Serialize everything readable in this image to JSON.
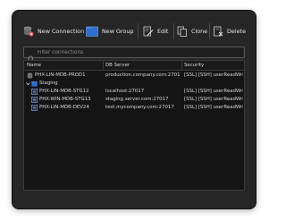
{
  "toolbar": {
    "new_connection_label": "New Connection",
    "new_group_label": "New Group",
    "edit_label": "Edit",
    "clone_label": "Clone",
    "delete_label": "Delete"
  },
  "filter": {
    "placeholder": "Filter connections"
  },
  "table": {
    "columns": [
      "Name",
      "DB Server",
      "Security"
    ],
    "rows": [
      {
        "name": "PHX-LIN-MDB-PROD1",
        "server": "production.company.com:27017",
        "security": "[SSL] [SSH] userReadWri..."
      },
      {
        "name": "Staging",
        "server": "",
        "security": ""
      },
      {
        "name": "PHX-LIN-MDB-STG12",
        "server": "localhost:27017",
        "security": "[SSL] [SSH] userReadWri..."
      },
      {
        "name": "PHX-WIN-MDB-STG13",
        "server": "staging.server.com:27017",
        "security": "[SSL] [SSH] userReadWri..."
      },
      {
        "name": "PHX-LIN-MDB-DEV24",
        "server": "test.mycompany.com:27017",
        "security": "[SSL] [SSH] userReadWri..."
      }
    ]
  },
  "colors": {
    "accent": "#2f6fd1",
    "window_bg": "#262626",
    "grid_bg": "#141414"
  }
}
